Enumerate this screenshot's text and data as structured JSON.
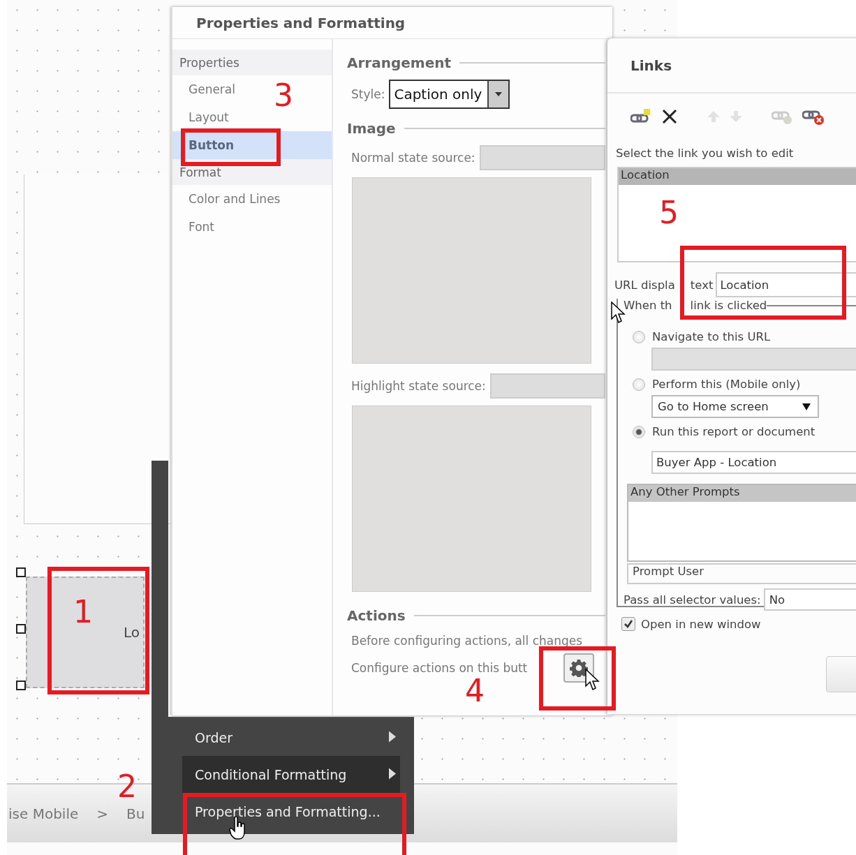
{
  "canvas": {
    "button_caption": "Lo",
    "breadcrumb": [
      "ise Mobile",
      ">",
      "Bu"
    ]
  },
  "dialog": {
    "title": "Properties and Formatting",
    "nav": [
      {
        "label": "Properties",
        "kind": "header",
        "selected": false
      },
      {
        "label": "General",
        "kind": "item",
        "selected": false
      },
      {
        "label": "Layout",
        "kind": "item",
        "selected": false
      },
      {
        "label": "Button",
        "kind": "item",
        "selected": true
      },
      {
        "label": "Format",
        "kind": "header",
        "selected": false
      },
      {
        "label": "Color and Lines",
        "kind": "item",
        "selected": false
      },
      {
        "label": "Font",
        "kind": "item",
        "selected": false
      }
    ],
    "arrangement": {
      "heading": "Arrangement",
      "style_label": "Style:",
      "style_value": "Caption only"
    },
    "image": {
      "heading": "Image",
      "normal_label": "Normal state source:",
      "highlight_label": "Highlight state source:"
    },
    "actions": {
      "heading": "Actions",
      "note": "Before configuring actions, all changes",
      "configure_label": "Configure actions on this butt"
    }
  },
  "context_menu": [
    {
      "label": "Order",
      "submenu": true,
      "selected": false
    },
    {
      "label": "Conditional Formatting",
      "submenu": true,
      "selected": true
    },
    {
      "label": "Properties and Formatting...",
      "submenu": false,
      "selected": false
    }
  ],
  "links": {
    "title": "Links",
    "prompt": "Select the link you wish to edit",
    "list": [
      {
        "label": "Location",
        "selected": true
      }
    ],
    "url_label": [
      "URL displa",
      "text"
    ],
    "url_value": "Location",
    "group_label": [
      "When th",
      "link is clicked"
    ],
    "options": [
      {
        "label": "Navigate to this URL",
        "selected": false,
        "kind": "url"
      },
      {
        "label": "Perform this (Mobile only)",
        "selected": false,
        "kind": "mobile"
      },
      {
        "label": "Run this report or document",
        "selected": true,
        "kind": "report"
      }
    ],
    "mobile_action": "Go to Home screen",
    "report": "Buyer App - Location",
    "prompts_header": "Any Other Prompts",
    "prompt_mode": "Prompt User",
    "pass_label": "Pass all selector values:",
    "pass_value": "No",
    "open_new_window": {
      "label": "Open in new window",
      "checked": true
    }
  },
  "annotations": [
    "1",
    "2",
    "3",
    "4",
    "5"
  ]
}
